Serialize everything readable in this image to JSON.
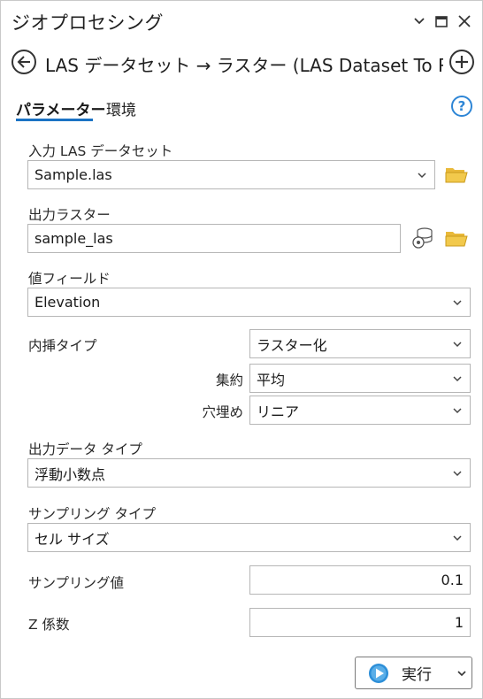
{
  "pane": {
    "title": "ジオプロセシング"
  },
  "tool": {
    "title": "LAS データセット → ラスター (LAS Dataset To R..."
  },
  "tabs": [
    {
      "label": "パラメーター",
      "active": true
    },
    {
      "label": "環境",
      "active": false
    }
  ],
  "params": {
    "input_las": {
      "label": "入力 LAS データセット",
      "value": "Sample.las"
    },
    "output_raster": {
      "label": "出力ラスター",
      "value": "sample_las"
    },
    "value_field": {
      "label": "値フィールド",
      "value": "Elevation"
    },
    "interpolation": {
      "label": "内挿タイプ",
      "value": "ラスター化",
      "aggregation": {
        "label": "集約",
        "value": "平均"
      },
      "void_fill": {
        "label": "穴埋め",
        "value": "リニア"
      }
    },
    "output_data_type": {
      "label": "出力データ タイプ",
      "value": "浮動小数点"
    },
    "sampling_type": {
      "label": "サンプリング タイプ",
      "value": "セル サイズ"
    },
    "sampling_value": {
      "label": "サンプリング値",
      "value": "0.1"
    },
    "z_factor": {
      "label": "Z 係数",
      "value": "1"
    }
  },
  "run_button": {
    "label": "実行"
  },
  "colors": {
    "accent": "#1b73c4",
    "folder": "#d8a626",
    "help": "#2e86d6"
  }
}
